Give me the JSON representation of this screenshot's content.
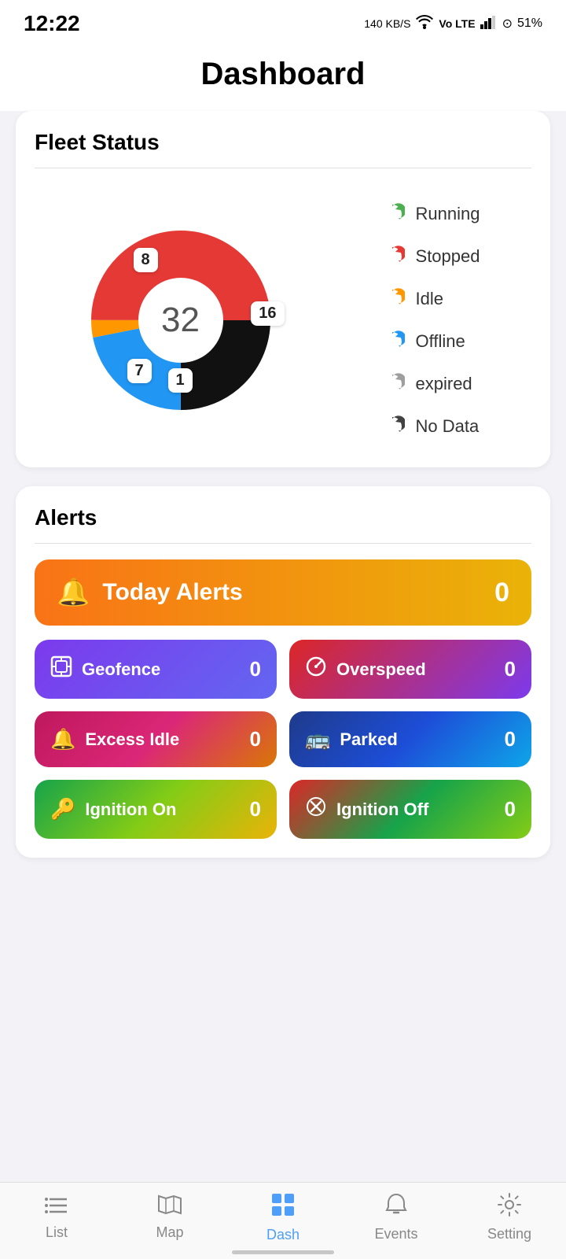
{
  "statusBar": {
    "time": "12:22",
    "networkSpeed": "140 KB/S",
    "battery": "51%"
  },
  "header": {
    "title": "Dashboard"
  },
  "fleetStatus": {
    "title": "Fleet Status",
    "total": "32",
    "segments": [
      {
        "label": "Running",
        "value": 16,
        "color": "#e53935",
        "percent": 50
      },
      {
        "label": "Stopped",
        "value": 8,
        "color": "#111111",
        "percent": 25
      },
      {
        "label": "Offline",
        "value": 7,
        "color": "#2196f3",
        "percent": 21.875
      },
      {
        "label": "Idle",
        "value": 1,
        "color": "#ff9800",
        "percent": 3.125
      }
    ],
    "legend": [
      {
        "label": "Running",
        "color": "#4caf50",
        "id": "running"
      },
      {
        "label": "Stopped",
        "color": "#e53935",
        "id": "stopped"
      },
      {
        "label": "Idle",
        "color": "#ff9800",
        "id": "idle"
      },
      {
        "label": "Offline",
        "color": "#2196f3",
        "id": "offline"
      },
      {
        "label": "expired",
        "color": "#9e9e9e",
        "id": "expired"
      },
      {
        "label": "No Data",
        "color": "#424242",
        "id": "nodata"
      }
    ],
    "badges": [
      {
        "value": "8",
        "pos": "top"
      },
      {
        "value": "16",
        "pos": "right"
      },
      {
        "value": "7",
        "pos": "bottomleft"
      },
      {
        "value": "1",
        "pos": "bottom"
      }
    ]
  },
  "alerts": {
    "title": "Alerts",
    "todayAlerts": {
      "label": "Today Alerts",
      "count": "0"
    },
    "items": [
      {
        "id": "geofence",
        "label": "Geofence",
        "count": "0",
        "icon": "⊞",
        "colorClass": "btn-geofence"
      },
      {
        "id": "overspeed",
        "label": "Overspeed",
        "count": "0",
        "icon": "⊘",
        "colorClass": "btn-overspeed"
      },
      {
        "id": "excessidle",
        "label": "Excess Idle",
        "count": "0",
        "icon": "🔔",
        "colorClass": "btn-excessidle"
      },
      {
        "id": "parked",
        "label": "Parked",
        "count": "0",
        "icon": "🚌",
        "colorClass": "btn-parked"
      },
      {
        "id": "ignitionon",
        "label": "Ignition On",
        "count": "0",
        "icon": "🔑",
        "colorClass": "btn-ignitionon"
      },
      {
        "id": "ignitionoff",
        "label": "Ignition Off",
        "count": "0",
        "icon": "⛔",
        "colorClass": "btn-ignitionoff"
      }
    ]
  },
  "bottomNav": {
    "items": [
      {
        "id": "list",
        "label": "List",
        "icon": "☰",
        "active": false
      },
      {
        "id": "map",
        "label": "Map",
        "icon": "🗺",
        "active": false
      },
      {
        "id": "dash",
        "label": "Dash",
        "icon": "⊞",
        "active": true
      },
      {
        "id": "events",
        "label": "Events",
        "icon": "🔔",
        "active": false
      },
      {
        "id": "setting",
        "label": "Setting",
        "icon": "⚙",
        "active": false
      }
    ]
  }
}
